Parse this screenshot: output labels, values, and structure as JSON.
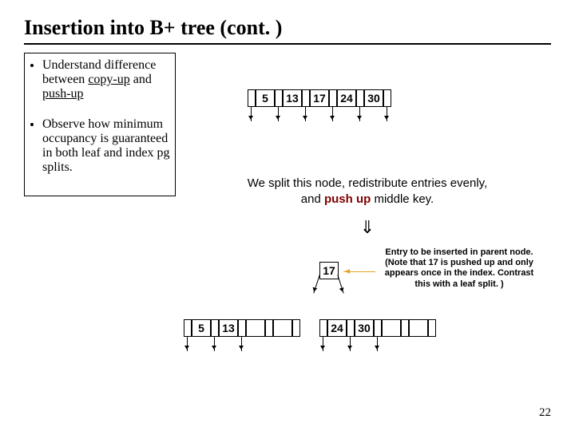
{
  "title": "Insertion into B+ tree (cont. )",
  "bullets": {
    "b1a": "Understand difference between ",
    "b1b": "copy-up",
    "b1c": " and ",
    "b1d": "push-up",
    "b2": "Observe how minimum occupancy is guaranteed in both leaf and index pg splits."
  },
  "node1": {
    "k1": "5",
    "k2": "13",
    "k3": "17",
    "k4": "24",
    "k5": "30"
  },
  "caption_line1": "We split this node, redistribute entries evenly,",
  "caption_line2a": "and ",
  "caption_line2b": "push up",
  "caption_line2c": " middle key.",
  "down_sym": "⇓",
  "mid_key": "17",
  "note_l1": "Entry to be inserted in parent node.",
  "note_l2": "(Note that 17 is pushed up and only",
  "note_l3": "appears once in the index. Contrast",
  "note_l4": "this with a leaf split. )",
  "left_node": {
    "k1": "5",
    "k2": "13"
  },
  "right_node": {
    "k1": "24",
    "k2": "30"
  },
  "page_number": "22"
}
